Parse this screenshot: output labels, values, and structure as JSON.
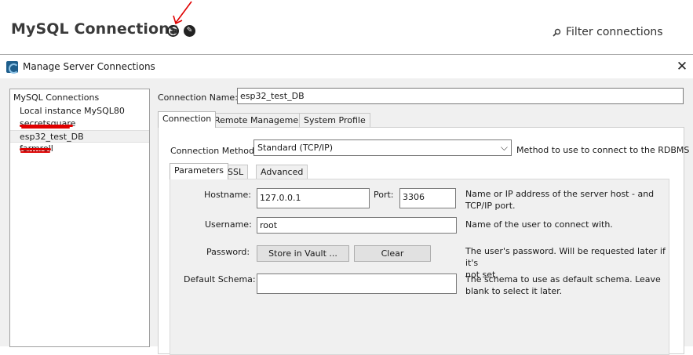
{
  "home": {
    "title": "MySQL Connections",
    "add_icon_glyph": "+",
    "manage_icon_glyph": "✎",
    "filter_icon": "search-icon",
    "filter_label": "Filter connections"
  },
  "dialog": {
    "title": "Manage Server Connections",
    "close_glyph": "✕"
  },
  "connections": {
    "header": "MySQL Connections",
    "items": [
      {
        "label": "Local instance MySQL80",
        "redacted": false,
        "selected": false
      },
      {
        "label": "secretsquare",
        "redacted": true,
        "selected": false
      },
      {
        "label": "esp32_test_DB",
        "redacted": false,
        "selected": true
      },
      {
        "label": "farmroll",
        "redacted": true,
        "selected": false
      }
    ]
  },
  "form": {
    "connection_name_label": "Connection Name:",
    "connection_name_value": "esp32_test_DB",
    "tabs": [
      "Connection",
      "Remote Management",
      "System Profile"
    ],
    "connection_method_label": "Connection Method:",
    "connection_method_value": "Standard (TCP/IP)",
    "connection_method_desc": "Method to use to connect to the RDBMS",
    "subtabs": [
      "Parameters",
      "SSL",
      "Advanced"
    ],
    "hostname_label": "Hostname:",
    "hostname_value": "127.0.0.1",
    "port_label": "Port:",
    "port_value": "3306",
    "hostname_desc_1": "Name or IP address of the server host - and",
    "hostname_desc_2": "TCP/IP port.",
    "username_label": "Username:",
    "username_value": "root",
    "username_desc": "Name of the user to connect with.",
    "password_label": "Password:",
    "store_vault_label": "Store in Vault ...",
    "clear_label": "Clear",
    "password_desc_1": "The user's password. Will be requested later if it's",
    "password_desc_2": "not set.",
    "schema_label": "Default Schema:",
    "schema_value": "",
    "schema_desc_1": "The schema to use as default schema. Leave",
    "schema_desc_2": "blank to select it later."
  },
  "colors": {
    "annotation_red": "#e00000",
    "selection_bg": "#f0f0f0",
    "dialog_bg": "#f0f0f0"
  }
}
